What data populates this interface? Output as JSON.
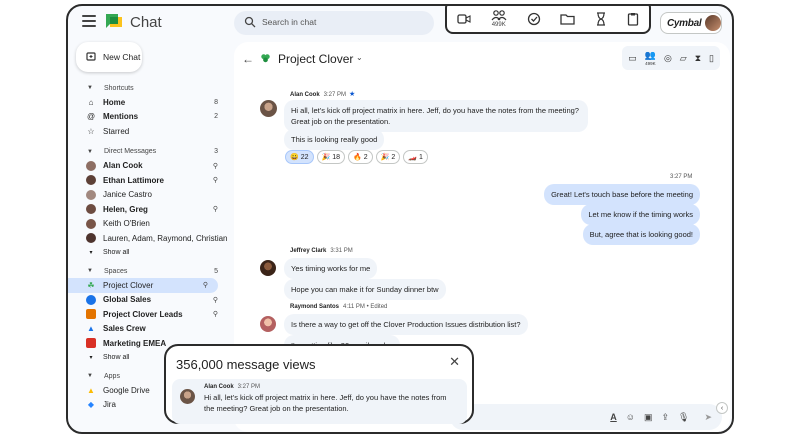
{
  "app": {
    "name": "Chat"
  },
  "search": {
    "placeholder": "Search in chat"
  },
  "brand": {
    "name": "Cymbal"
  },
  "float_toolbar": {
    "members_count": "499K"
  },
  "new_chat": {
    "label": "New Chat"
  },
  "sidebar": {
    "shortcuts": {
      "title": "Shortcuts",
      "items": [
        {
          "label": "Home",
          "count": "8"
        },
        {
          "label": "Mentions",
          "count": "2"
        },
        {
          "label": "Starred",
          "count": ""
        }
      ]
    },
    "dms": {
      "title": "Direct Messages",
      "count": "3",
      "items": [
        {
          "label": "Alan Cook"
        },
        {
          "label": "Ethan Lattimore"
        },
        {
          "label": "Janice Castro"
        },
        {
          "label": "Helen, Greg"
        },
        {
          "label": "Keith O'Brien"
        },
        {
          "label": "Lauren, Adam, Raymond, Christian"
        }
      ],
      "show_all": "Show all"
    },
    "spaces": {
      "title": "Spaces",
      "count": "5",
      "items": [
        {
          "label": "Project Clover"
        },
        {
          "label": "Global Sales"
        },
        {
          "label": "Project Clover Leads"
        },
        {
          "label": "Sales Crew"
        },
        {
          "label": "Marketing EMEA"
        }
      ],
      "show_all": "Show all"
    },
    "apps": {
      "title": "Apps",
      "items": [
        {
          "label": "Google Drive"
        },
        {
          "label": "Jira"
        }
      ]
    }
  },
  "room": {
    "title": "Project Clover",
    "members_count": "499K"
  },
  "messages": {
    "alan": {
      "name": "Alan Cook",
      "time": "3:27 PM",
      "text1": "Hi all, let's kick off project matrix in here. Jeff, do you have the notes from the meeting? Great job on the presentation.",
      "text2": "This is looking really good",
      "reactions": [
        {
          "emoji": "😀",
          "count": "22"
        },
        {
          "emoji": "🎉",
          "count": "18"
        },
        {
          "emoji": "🔥",
          "count": "2"
        },
        {
          "emoji": "🎉",
          "count": "2"
        },
        {
          "emoji": "🏎️",
          "count": "1"
        }
      ]
    },
    "me": {
      "time": "3:27 PM",
      "text1": "Great! Let's touch base before the meeting",
      "text2": "Let me know if the timing works",
      "text3": "But, agree that is looking good!"
    },
    "jeffrey": {
      "name": "Jeffrey Clark",
      "time": "3:31 PM",
      "text1": "Yes timing works for me",
      "text2": "Hope you can make it for Sunday dinner btw"
    },
    "raymond": {
      "name": "Raymond Santos",
      "time": "4:11 PM • Edited",
      "text1": "Is there a way to get off the Clover Production Issues distribution list?",
      "text2": "I'm getting like 30 emails a day"
    }
  },
  "views_popover": {
    "title": "356,000 message views",
    "author": "Alan Cook",
    "time": "3:27 PM",
    "text": "Hi all, let's kick off project matrix in here. Jeff, do you have the notes from the meeting? Great job on the presentation."
  }
}
